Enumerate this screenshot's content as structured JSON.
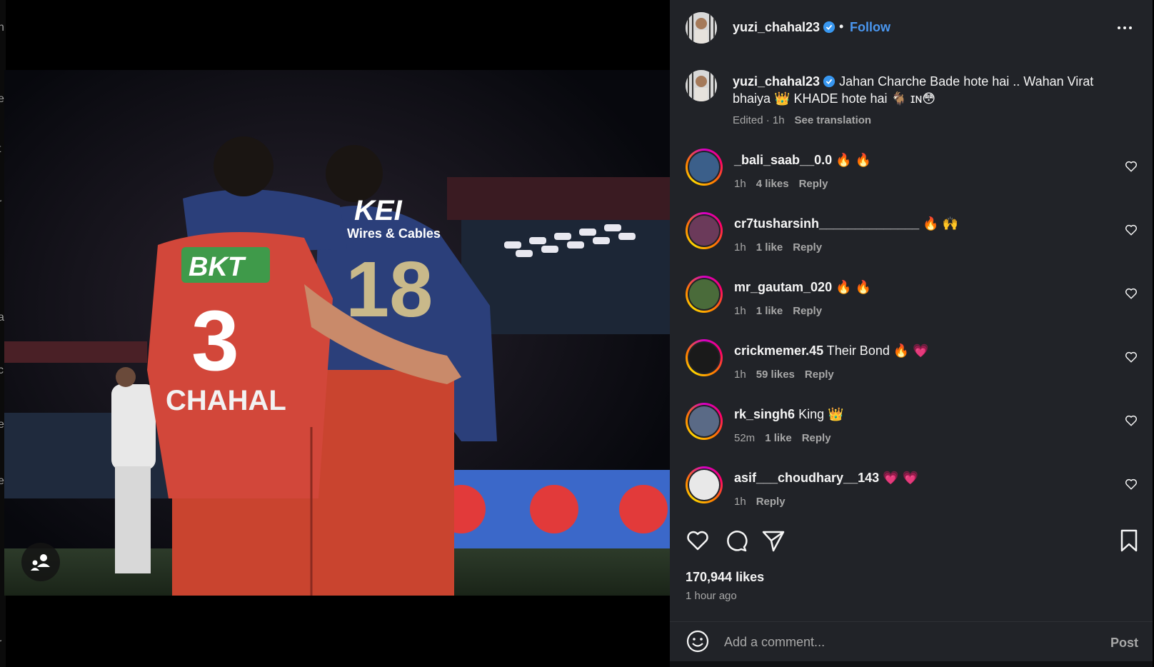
{
  "background": {
    "edge_letters": [
      "n",
      "e",
      "t",
      "r",
      "a",
      "c",
      "e",
      "e",
      "r"
    ]
  },
  "post": {
    "author": "yuzi_chahal23",
    "follow_label": "Follow",
    "dot": "•",
    "caption": "Jahan Charche Bade hote hai .. Wahan Virat bhaiya 👑 KHADE hote hai 🐐 ɪɴ😳",
    "caption_meta": "Edited · 1h",
    "see_translation": "See translation",
    "likes": "170,944 likes",
    "time_ago": "1 hour ago",
    "jersey_left": {
      "sponsor": "BKT",
      "number": "3",
      "name": "CHAHAL"
    },
    "jersey_right": {
      "sponsor": "KEI",
      "sponsor_sub": "Wires & Cables",
      "number": "18"
    }
  },
  "comments": [
    {
      "user": "_bali_saab__0.0",
      "text": "🔥 🔥",
      "time": "1h",
      "likes": "4 likes",
      "reply": "Reply",
      "avatar_color": "#3b5f8a"
    },
    {
      "user": "cr7tusharsinh______________",
      "text": "🔥 🙌",
      "time": "1h",
      "likes": "1 like",
      "reply": "Reply",
      "avatar_color": "#6b3a5a"
    },
    {
      "user": "mr_gautam_020",
      "text": "🔥 🔥",
      "time": "1h",
      "likes": "1 like",
      "reply": "Reply",
      "avatar_color": "#4a6b3a"
    },
    {
      "user": "crickmemer.45",
      "text": "Their Bond 🔥 💗",
      "time": "1h",
      "likes": "59 likes",
      "reply": "Reply",
      "avatar_color": "#1a1a1a"
    },
    {
      "user": "rk_singh6",
      "text": "King 👑",
      "time": "52m",
      "likes": "1 like",
      "reply": "Reply",
      "avatar_color": "#5a6a86"
    },
    {
      "user": "asif___choudhary__143",
      "text": "💗 💗",
      "time": "1h",
      "likes": "",
      "reply": "Reply",
      "avatar_color": "#e8e8e8"
    }
  ],
  "comment_box": {
    "placeholder": "Add a comment...",
    "post_label": "Post"
  },
  "icons": {
    "verified": "verified-badge-icon",
    "more": "more-options-icon",
    "like": "heart-icon",
    "comment": "comment-icon",
    "share": "share-icon",
    "save": "bookmark-icon",
    "emoji": "emoji-icon",
    "tag": "tagged-people-icon"
  },
  "colors": {
    "panel_bg": "#212328",
    "link_blue": "#4a97f0",
    "muted": "#a8a8a8"
  }
}
